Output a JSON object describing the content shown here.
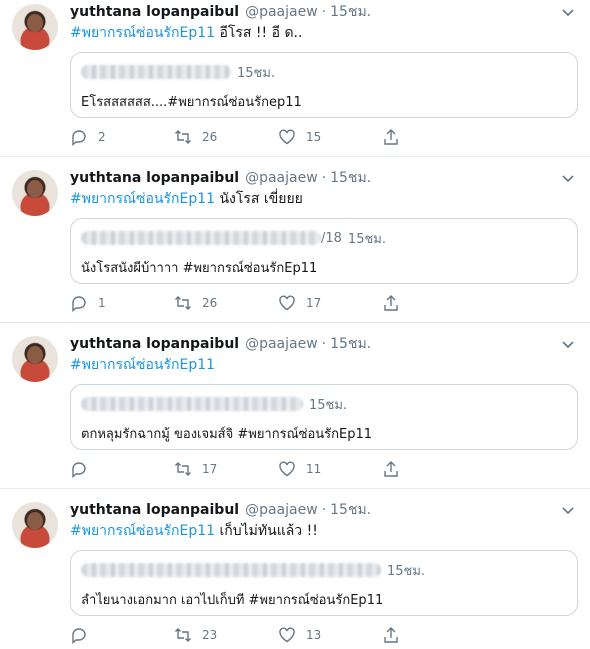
{
  "colors": {
    "accent": "#1b95e0",
    "secondary": "#657786",
    "border": "#ccd6dd"
  },
  "tweets": [
    {
      "name": "yuthtana lopanpaibul",
      "handle": "@paajaew",
      "dot": "·",
      "time": "15ชม.",
      "hashtag": "#พยากรณ์ซ่อนรักEp11",
      "text": " อีโรส !! อี ด..",
      "quote": {
        "time": "15ชม.",
        "text": "Eโรสสสสสส....#พยากรณ์ซ่อนรักep11"
      },
      "replies": "2",
      "retweets": "26",
      "likes": "15"
    },
    {
      "name": "yuthtana lopanpaibul",
      "handle": "@paajaew",
      "dot": "·",
      "time": "15ชม.",
      "hashtag": "#พยากรณ์ซ่อนรักEp11",
      "text": " นังโรส เขี่ยยย",
      "quote": {
        "date_fragment": "/18",
        "time": "15ชม.",
        "text": "นังโรสนังผีบ้าาาา #พยากรณ์ซ่อนรักEp11"
      },
      "replies": "1",
      "retweets": "26",
      "likes": "17"
    },
    {
      "name": "yuthtana lopanpaibul",
      "handle": "@paajaew",
      "dot": "·",
      "time": "15ชม.",
      "hashtag": "#พยากรณ์ซ่อนรักEp11",
      "text": "",
      "quote": {
        "time": "15ชม.",
        "text": "ตกหลุมรักฉากมู้ ของเจมส์จิ #พยากรณ์ซ่อนรักEp11"
      },
      "replies": "",
      "retweets": "17",
      "likes": "11"
    },
    {
      "name": "yuthtana lopanpaibul",
      "handle": "@paajaew",
      "dot": "·",
      "time": "15ชม.",
      "hashtag": "#พยากรณ์ซ่อนรักEp11",
      "text": " เก็บไม่ทันแล้ว !!",
      "quote": {
        "time": "15ชม.",
        "text": "ลำไยนางเอกมาก เอาไปเก็บที #พยากรณ์ซ่อนรักEp11"
      },
      "replies": "",
      "retweets": "23",
      "likes": "13"
    }
  ]
}
